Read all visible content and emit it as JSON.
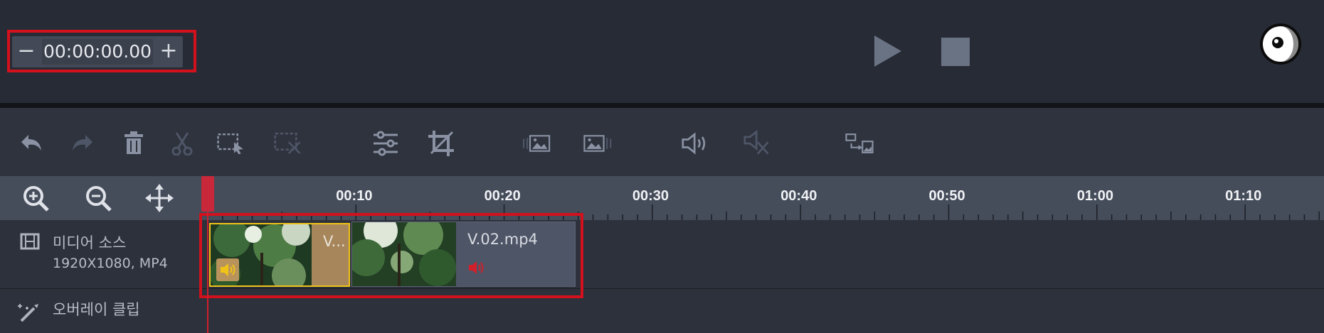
{
  "timecode": {
    "minus": "−",
    "value": "00:00:00.00",
    "plus": "+"
  },
  "ruler": {
    "labels": [
      "00:10",
      "00:20",
      "00:30",
      "00:40",
      "00:50",
      "01:00",
      "01:10"
    ]
  },
  "tracks": {
    "media": {
      "title": "미디어 소스",
      "subtitle": "1920X1080, MP4"
    },
    "overlay": {
      "title": "오버레이 클립"
    }
  },
  "clips": [
    {
      "name": "V...",
      "selected": true
    },
    {
      "name": "V.02.mp4",
      "selected": false
    }
  ],
  "colors": {
    "accent_red": "#d3111c",
    "selected_clip": "#a7865b",
    "clip_border": "#f0c318"
  }
}
